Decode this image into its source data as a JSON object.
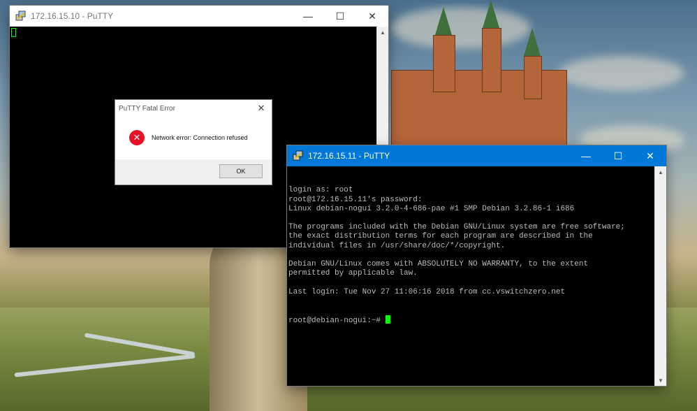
{
  "windows": {
    "back": {
      "title": "172.16.15.10 - PuTTY",
      "controls": {
        "minimize": "—",
        "maximize": "☐",
        "close": "✕"
      }
    },
    "front": {
      "title": "172.16.15.11 - PuTTY",
      "controls": {
        "minimize": "—",
        "maximize": "☐",
        "close": "✕"
      },
      "terminal_lines": [
        "login as: root",
        "root@172.16.15.11's password:",
        "Linux debian-nogui 3.2.0-4-686-pae #1 SMP Debian 3.2.86-1 i686",
        "",
        "The programs included with the Debian GNU/Linux system are free software;",
        "the exact distribution terms for each program are described in the",
        "individual files in /usr/share/doc/*/copyright.",
        "",
        "Debian GNU/Linux comes with ABSOLUTELY NO WARRANTY, to the extent",
        "permitted by applicable law.",
        "",
        "Last login: Tue Nov 27 11:06:16 2018 from cc.vswitchzero.net"
      ],
      "prompt": "root@debian-nogui:~# "
    }
  },
  "dialog": {
    "title": "PuTTY Fatal Error",
    "message": "Network error: Connection refused",
    "ok_label": "OK",
    "close_glyph": "✕",
    "error_glyph": "✕"
  },
  "colors": {
    "accent": "#0078d7",
    "cursor": "#00ff00",
    "terminal_bg": "#000000",
    "terminal_fg": "#bbbbbb",
    "error": "#e81123"
  },
  "scroll_arrows": {
    "up": "▲",
    "down": "▼"
  }
}
